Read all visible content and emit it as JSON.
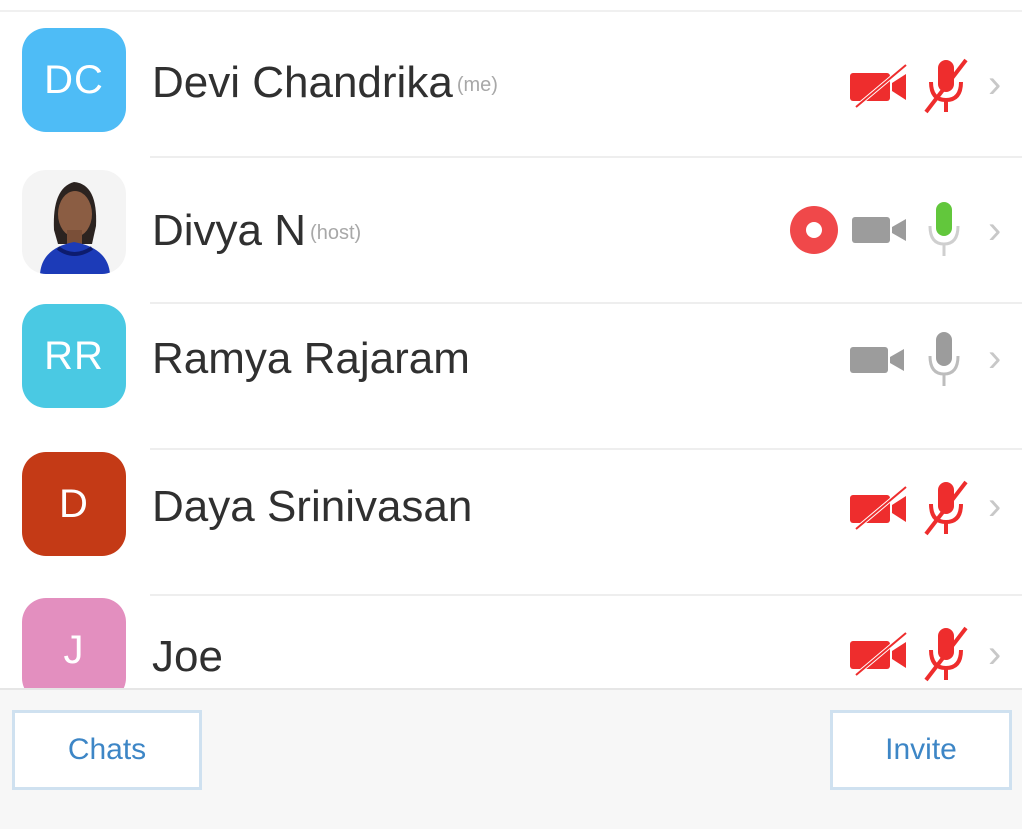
{
  "participants": [
    {
      "initials": "DC",
      "name": "Devi Chandrika",
      "tag": "(me)",
      "avatar_color": "#4ebcf6",
      "video": "off",
      "audio": "muted"
    },
    {
      "initials": "",
      "name": "Divya N",
      "tag": "(host)",
      "avatar_color": "#ffffff",
      "recording": true,
      "video": "on",
      "audio": "speaking"
    },
    {
      "initials": "RR",
      "name": "Ramya Rajaram",
      "tag": "",
      "avatar_color": "#4ac9e3",
      "video": "on",
      "audio": "idle"
    },
    {
      "initials": "D",
      "name": "Daya Srinivasan",
      "tag": "",
      "avatar_color": "#c43a16",
      "video": "off",
      "audio": "muted"
    },
    {
      "initials": "J",
      "name": "Joe",
      "tag": "",
      "avatar_color": "#e38fbf",
      "video": "off",
      "audio": "muted"
    }
  ],
  "footer": {
    "chats_label": "Chats",
    "invite_label": "Invite"
  },
  "colors": {
    "muted": "#ee2d2d",
    "speaking": "#62c73c",
    "icon_gray": "#9c9c9c",
    "recording": "#f0484a",
    "button_text": "#3d86c6"
  }
}
